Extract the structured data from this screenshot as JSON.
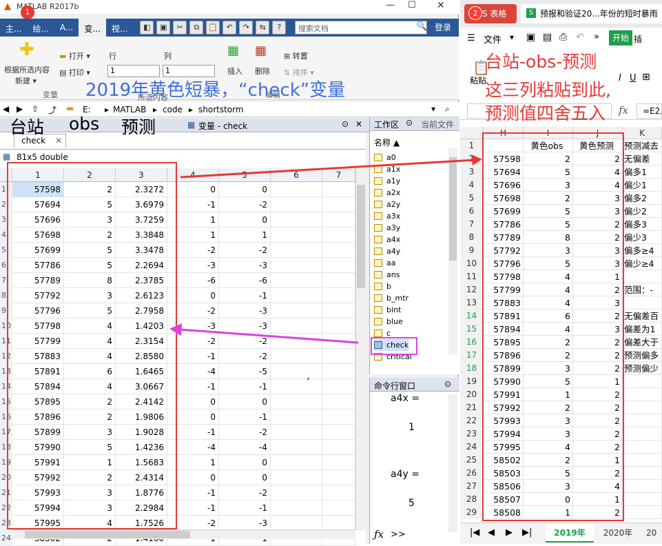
{
  "matlab": {
    "title": "MATLAB R2017b",
    "badge": "1",
    "tabs": [
      "主...",
      "绘...",
      "A...",
      "变...",
      "视..."
    ],
    "search_placeholder": "搜索文档",
    "login": "登录",
    "ribbon": {
      "new_from_selection": "根据所选内容",
      "new_label": "新建 ▾",
      "open": "打开 ▾",
      "print": "打印 ▾",
      "row_label": "行",
      "col_label": "列",
      "row_value": "1",
      "col_value": "1",
      "insert": "插入",
      "delete": "删除",
      "transpose": "转置",
      "sort": "排序 ▾",
      "group_variable": "变量",
      "group_selection": "所选内容",
      "group_edit": "编辑"
    },
    "address": [
      "E:",
      "MATLAB",
      "code",
      "shortstorm"
    ],
    "variable_tab_title": "变量 - check",
    "doc_tab": "check",
    "var_size": "81x5 double",
    "columns": [
      "1",
      "2",
      "3",
      "4",
      "5",
      "6",
      "7"
    ],
    "rows": [
      [
        "1",
        "57598",
        "2",
        "2.3272",
        "0",
        "0"
      ],
      [
        "2",
        "57694",
        "5",
        "3.6979",
        "-1",
        "-2"
      ],
      [
        "3",
        "57696",
        "3",
        "3.7259",
        "1",
        "0"
      ],
      [
        "4",
        "57698",
        "2",
        "3.3848",
        "1",
        "1"
      ],
      [
        "5",
        "57699",
        "5",
        "3.3478",
        "-2",
        "-2"
      ],
      [
        "6",
        "57786",
        "5",
        "2.2694",
        "-3",
        "-3"
      ],
      [
        "7",
        "57789",
        "8",
        "2.3785",
        "-6",
        "-6"
      ],
      [
        "8",
        "57792",
        "3",
        "2.6123",
        "0",
        "-1"
      ],
      [
        "9",
        "57796",
        "5",
        "2.7958",
        "-2",
        "-3"
      ],
      [
        "10",
        "57798",
        "4",
        "1.4203",
        "-3",
        "-3"
      ],
      [
        "11",
        "57799",
        "4",
        "2.3154",
        "-2",
        "-2"
      ],
      [
        "12",
        "57883",
        "4",
        "2.8580",
        "-1",
        "-2"
      ],
      [
        "13",
        "57891",
        "6",
        "1.6465",
        "-4",
        "-5"
      ],
      [
        "14",
        "57894",
        "4",
        "3.0667",
        "-1",
        "-1"
      ],
      [
        "15",
        "57895",
        "2",
        "2.4142",
        "0",
        "0"
      ],
      [
        "16",
        "57896",
        "2",
        "1.9806",
        "0",
        "-1"
      ],
      [
        "17",
        "57899",
        "3",
        "1.9028",
        "-1",
        "-2"
      ],
      [
        "18",
        "57990",
        "5",
        "1.4236",
        "-4",
        "-4"
      ],
      [
        "19",
        "57991",
        "1",
        "1.5683",
        "1",
        "0"
      ],
      [
        "20",
        "57992",
        "2",
        "2.4314",
        "0",
        "0"
      ],
      [
        "21",
        "57993",
        "3",
        "1.8776",
        "-1",
        "-2"
      ],
      [
        "22",
        "57994",
        "3",
        "2.2984",
        "-1",
        "-1"
      ],
      [
        "23",
        "57995",
        "4",
        "1.7526",
        "-2",
        "-3"
      ],
      [
        "24",
        "58502",
        "2",
        "1.4160",
        "-1",
        "-1"
      ]
    ],
    "workspace_title": "工作区",
    "current_folder_tab": "当前文件",
    "ws_header": "名称 ▲",
    "ws_vars": [
      "a0",
      "a1x",
      "a1y",
      "a2x",
      "a2y",
      "a3x",
      "a3y",
      "a4x",
      "a4y",
      "aa",
      "ans",
      "b",
      "b_mtr",
      "bint",
      "blue",
      "c",
      "check",
      "critical"
    ],
    "cmd_title": "命令行窗口",
    "cmd_lines": [
      {
        "label": "a4x =",
        "value": "1"
      },
      {
        "label": "a4y =",
        "value": "5"
      }
    ],
    "cmd_prompt": ">>"
  },
  "wps": {
    "badge": "2",
    "app_tab": "S 表格",
    "doc_tab": "预报和验证20...年份的短时暴雨",
    "file_menu": "文件",
    "start_tab": "开始",
    "paste": "粘贴",
    "formula_fx": "fx",
    "formula_value": "=E2,",
    "col_headers": [
      "H",
      "I",
      "J",
      "K"
    ],
    "rows": [
      [
        "1",
        "",
        "黄色obs",
        "黄色预测",
        "预测减去"
      ],
      [
        "2",
        "57598",
        "2",
        "2",
        "无偏差"
      ],
      [
        "3",
        "57694",
        "5",
        "4",
        "偏多1"
      ],
      [
        "4",
        "57696",
        "3",
        "4",
        "偏少1"
      ],
      [
        "5",
        "57698",
        "2",
        "3",
        "偏多2"
      ],
      [
        "6",
        "57699",
        "5",
        "3",
        "偏少2"
      ],
      [
        "7",
        "57786",
        "5",
        "2",
        "偏多3"
      ],
      [
        "8",
        "57789",
        "8",
        "2",
        "偏少3"
      ],
      [
        "9",
        "57792",
        "3",
        "3",
        "偏多≥4"
      ],
      [
        "10",
        "57796",
        "5",
        "3",
        "偏少≥4"
      ],
      [
        "11",
        "57798",
        "4",
        "1",
        ""
      ],
      [
        "12",
        "57799",
        "4",
        "2",
        "范围：-"
      ],
      [
        "13",
        "57883",
        "4",
        "3",
        ""
      ],
      [
        "14",
        "57891",
        "6",
        "2",
        "无偏差百"
      ],
      [
        "15",
        "57894",
        "4",
        "3",
        "偏差为1"
      ],
      [
        "16",
        "57895",
        "2",
        "2",
        "偏差大于"
      ],
      [
        "17",
        "57896",
        "2",
        "2",
        "预测偏多"
      ],
      [
        "18",
        "57899",
        "3",
        "2",
        "预测偏少"
      ],
      [
        "19",
        "57990",
        "5",
        "1",
        ""
      ],
      [
        "20",
        "57991",
        "1",
        "2",
        ""
      ],
      [
        "21",
        "57992",
        "2",
        "2",
        ""
      ],
      [
        "22",
        "57993",
        "3",
        "2",
        ""
      ],
      [
        "23",
        "57994",
        "3",
        "2",
        ""
      ],
      [
        "24",
        "57995",
        "4",
        "2",
        ""
      ],
      [
        "25",
        "58502",
        "2",
        "1",
        ""
      ],
      [
        "26",
        "58503",
        "5",
        "2",
        ""
      ],
      [
        "27",
        "58506",
        "3",
        "4",
        ""
      ],
      [
        "28",
        "58507",
        "0",
        "1",
        ""
      ],
      [
        "29",
        "58508",
        "1",
        "2",
        ""
      ]
    ],
    "sheet_tabs": [
      "2019年",
      "2020年",
      "20"
    ]
  },
  "annotations": {
    "blue_title": "2019年黄色短暴，“check”变量",
    "left_labels": [
      "台站",
      "obs",
      "预测"
    ],
    "red_lines": [
      "台站-obs-预测",
      "这三列粘贴到此,",
      "预测值四舍五入"
    ]
  },
  "colors": {
    "matlab_blue": "#2b5797",
    "annotation_blue": "#3f6fd8",
    "annotation_red": "#e53935",
    "magenta": "#e040e0",
    "wps_green": "#1e9e4a"
  }
}
